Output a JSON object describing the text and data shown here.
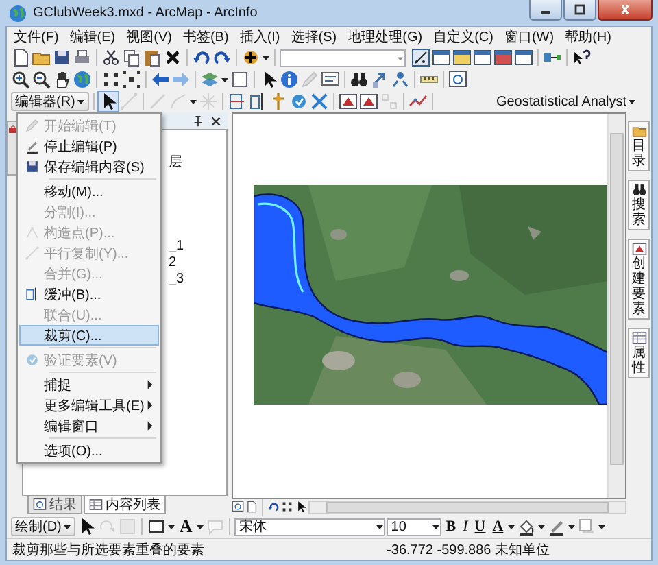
{
  "window": {
    "title": "GClubWeek3.mxd - ArcMap - ArcInfo"
  },
  "menu_bar": [
    "文件(F)",
    "编辑(E)",
    "视图(V)",
    "书签(B)",
    "插入(I)",
    "选择(S)",
    "地理处理(G)",
    "自定义(C)",
    "窗口(W)",
    "帮助(H)"
  ],
  "editor_toolbar": {
    "label": "编辑器(R)"
  },
  "geostatistical_toolbar": {
    "label": "Geostatistical Analyst"
  },
  "editor_menu": [
    {
      "kind": "item",
      "label": "开始编辑(T)",
      "disabled": true,
      "selected": false,
      "submenu": false
    },
    {
      "kind": "item",
      "label": "停止编辑(P)",
      "disabled": false,
      "selected": false,
      "submenu": false
    },
    {
      "kind": "item",
      "label": "保存编辑内容(S)",
      "disabled": false,
      "selected": false,
      "submenu": false
    },
    {
      "kind": "separator"
    },
    {
      "kind": "item",
      "label": "移动(M)...",
      "disabled": false,
      "selected": false,
      "submenu": false
    },
    {
      "kind": "item",
      "label": "分割(I)...",
      "disabled": true,
      "selected": false,
      "submenu": false
    },
    {
      "kind": "item",
      "label": "构造点(P)...",
      "disabled": true,
      "selected": false,
      "submenu": false
    },
    {
      "kind": "item",
      "label": "平行复制(Y)...",
      "disabled": true,
      "selected": false,
      "submenu": false
    },
    {
      "kind": "item",
      "label": "合并(G)...",
      "disabled": true,
      "selected": false,
      "submenu": false
    },
    {
      "kind": "item",
      "label": "缓冲(B)...",
      "disabled": false,
      "selected": false,
      "submenu": false
    },
    {
      "kind": "item",
      "label": "联合(U)...",
      "disabled": true,
      "selected": false,
      "submenu": false
    },
    {
      "kind": "item",
      "label": "裁剪(C)...",
      "disabled": false,
      "selected": true,
      "submenu": false
    },
    {
      "kind": "separator"
    },
    {
      "kind": "item",
      "label": "验证要素(V)",
      "disabled": true,
      "selected": false,
      "submenu": false
    },
    {
      "kind": "separator"
    },
    {
      "kind": "item",
      "label": "捕捉",
      "disabled": false,
      "selected": false,
      "submenu": true
    },
    {
      "kind": "item",
      "label": "更多编辑工具(E)",
      "disabled": false,
      "selected": false,
      "submenu": true
    },
    {
      "kind": "item",
      "label": "编辑窗口",
      "disabled": false,
      "selected": false,
      "submenu": true
    },
    {
      "kind": "separator"
    },
    {
      "kind": "item",
      "label": "选项(O)...",
      "disabled": false,
      "selected": false,
      "submenu": false
    }
  ],
  "toc": {
    "fragments": [
      "层",
      "_1",
      "2",
      "_3"
    ],
    "tabs": [
      {
        "label": "结果",
        "selected": false
      },
      {
        "label": "内容列表",
        "selected": true
      }
    ]
  },
  "right_dock_tabs": [
    "目录",
    "搜索",
    "创建要素",
    "属性"
  ],
  "drawing_toolbar": {
    "label": "绘制(D)",
    "text_tool": "A",
    "font": "宋体",
    "font_size": "10",
    "format_buttons": [
      "B",
      "I",
      "U",
      "A"
    ]
  },
  "status_bar": {
    "message": "裁剪那些与所选要素重叠的要素",
    "coordinates": "-36.772 -599.886 未知单位"
  }
}
